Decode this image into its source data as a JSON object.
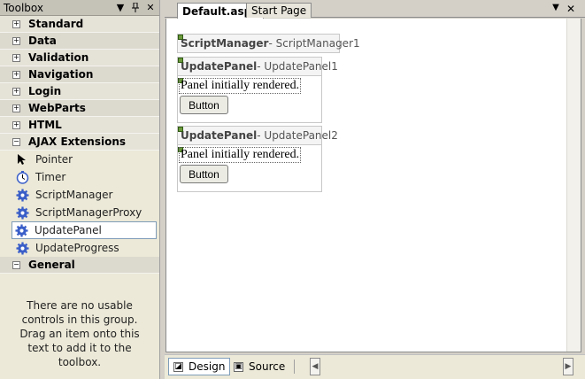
{
  "toolbox": {
    "title": "Toolbox",
    "categories_top": [
      {
        "label": "Standard",
        "expander": "+"
      },
      {
        "label": "Data",
        "expander": "+"
      },
      {
        "label": "Validation",
        "expander": "+"
      },
      {
        "label": "Navigation",
        "expander": "+"
      },
      {
        "label": "Login",
        "expander": "+"
      },
      {
        "label": "WebParts",
        "expander": "+"
      },
      {
        "label": "HTML",
        "expander": "+"
      }
    ],
    "ajax": {
      "label": "AJAX Extensions",
      "expander": "−",
      "items": [
        {
          "label": "Pointer",
          "icon": "pointer-icon"
        },
        {
          "label": "Timer",
          "icon": "timer-icon"
        },
        {
          "label": "ScriptManager",
          "icon": "gear-icon"
        },
        {
          "label": "ScriptManagerProxy",
          "icon": "gear-icon"
        },
        {
          "label": "UpdatePanel",
          "icon": "gear-icon",
          "selected": true
        },
        {
          "label": "UpdateProgress",
          "icon": "gear-icon"
        }
      ]
    },
    "general": {
      "label": "General",
      "expander": "−",
      "message": "There are no usable controls in this group. Drag an item onto this text to add it to the toolbox."
    }
  },
  "tabs": [
    {
      "label": "Default.aspx",
      "active": true
    },
    {
      "label": "Start Page",
      "active": false
    }
  ],
  "designer": {
    "script_manager": {
      "kind": "ScriptManager",
      "id": " - ScriptManager1"
    },
    "panels": [
      {
        "kind": "UpdatePanel",
        "id": " - UpdatePanel1",
        "text": "Panel initially rendered.",
        "button": "Button"
      },
      {
        "kind": "UpdatePanel",
        "id": " - UpdatePanel2",
        "text": "Panel initially rendered.",
        "button": "Button"
      }
    ]
  },
  "views": {
    "design": "Design",
    "source": "Source"
  },
  "colors": {
    "selection_border": "#7f9db9",
    "gear": "#3a5fc8",
    "designer_glyph": "#6c9a3c"
  }
}
